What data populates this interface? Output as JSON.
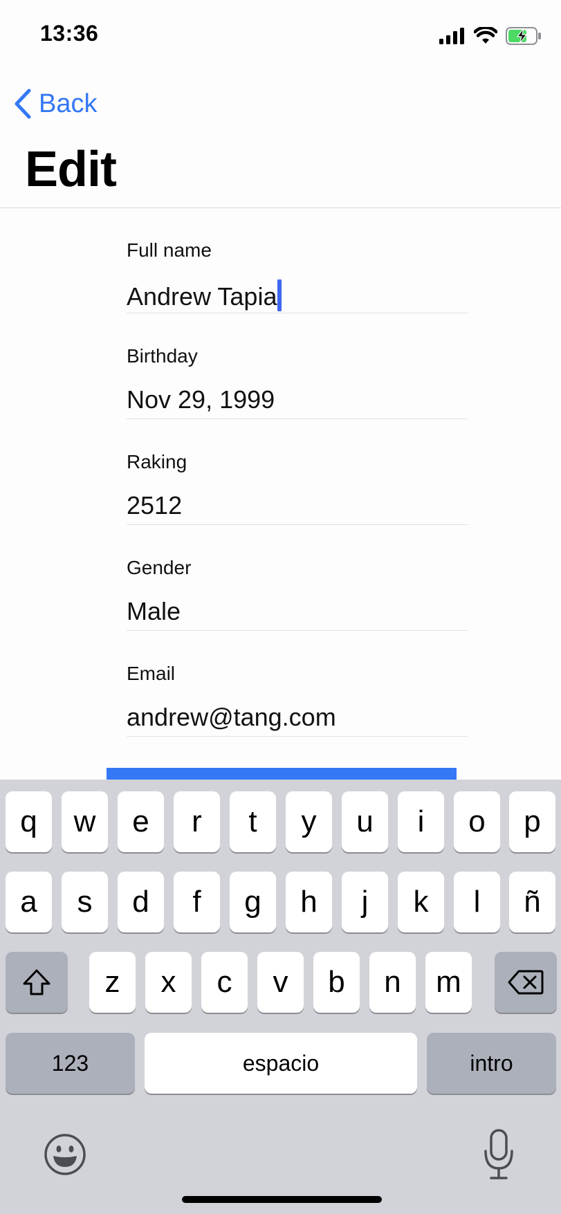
{
  "status_bar": {
    "time": "13:36"
  },
  "nav": {
    "back_label": "Back",
    "title": "Edit"
  },
  "form": {
    "fields": [
      {
        "label": "Full name",
        "value": "Andrew Tapia"
      },
      {
        "label": "Birthday",
        "value": "Nov 29, 1999"
      },
      {
        "label": "Raking",
        "value": "2512"
      },
      {
        "label": "Gender",
        "value": "Male"
      },
      {
        "label": "Email",
        "value": "andrew@tang.com"
      }
    ]
  },
  "keyboard": {
    "row1": [
      "q",
      "w",
      "e",
      "r",
      "t",
      "y",
      "u",
      "i",
      "o",
      "p"
    ],
    "row2": [
      "a",
      "s",
      "d",
      "f",
      "g",
      "h",
      "j",
      "k",
      "l",
      "ñ"
    ],
    "row3": [
      "z",
      "x",
      "c",
      "v",
      "b",
      "n",
      "m"
    ],
    "numbers_label": "123",
    "space_label": "espacio",
    "return_label": "intro"
  },
  "colors": {
    "accent": "#3478f6",
    "keyboard_bg": "#d1d3d9",
    "battery": "#4cd964"
  }
}
